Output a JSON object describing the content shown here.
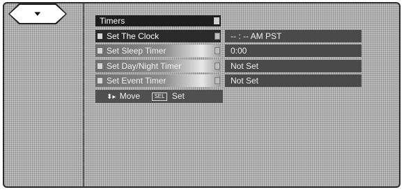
{
  "menu_badge": {
    "icon": "menu-chevron-icon",
    "glyph": "▾"
  },
  "panel": {
    "title": "Timers"
  },
  "items": [
    {
      "label": "Set The Clock",
      "value": "-- : --  AM PST"
    },
    {
      "label": "Set Sleep Timer",
      "value": "0:00"
    },
    {
      "label": "Set Day/Night Timer",
      "value": "Not Set"
    },
    {
      "label": "Set Event Timer",
      "value": "Not Set"
    }
  ],
  "hint": {
    "arrows_glyph": "⬍▸",
    "move_label": "Move",
    "sel_key": "SEL",
    "set_label": "Set"
  }
}
